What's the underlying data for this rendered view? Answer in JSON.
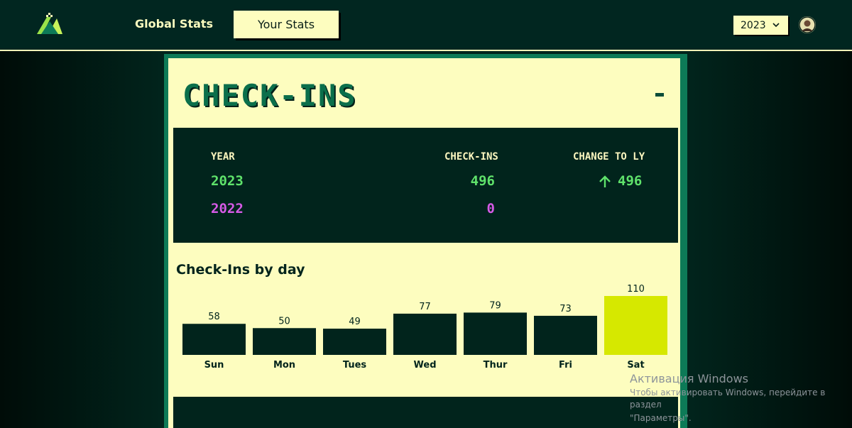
{
  "header": {
    "nav": {
      "global_label": "Global Stats",
      "yours_label": "Your Stats"
    },
    "year_select": {
      "value": "2023",
      "icon": "chevron-down-icon"
    }
  },
  "card": {
    "title": "CHECK-INS",
    "stats": {
      "headers": {
        "year": "YEAR",
        "checkins": "CHECK-INS",
        "change": "CHANGE TO LY"
      },
      "rows": [
        {
          "year": "2023",
          "checkins": "496",
          "change": "496",
          "change_direction": "up",
          "color": "#5fe26b"
        },
        {
          "year": "2022",
          "checkins": "0",
          "change": "",
          "color": "#d65ae6"
        }
      ]
    },
    "by_day_title": "Check-Ins by day"
  },
  "chart_data": {
    "type": "bar",
    "title": "Check-Ins by day",
    "categories": [
      "Sun",
      "Mon",
      "Tues",
      "Wed",
      "Thur",
      "Fri",
      "Sat"
    ],
    "values": [
      58,
      50,
      49,
      77,
      79,
      73,
      110
    ],
    "bar_color": "#01241c",
    "highlight_index": 6,
    "highlight_color": "#d6e800",
    "ylim": [
      0,
      110
    ],
    "grid": false
  },
  "watermark": {
    "title": "Активация Windows",
    "line1": "Чтобы активировать Windows, перейдите в раздел",
    "line2": "\"Параметры\"."
  },
  "colors": {
    "background": "#01241c",
    "accent_cream": "#fdfdbf",
    "accent_green": "#0d7a57"
  }
}
